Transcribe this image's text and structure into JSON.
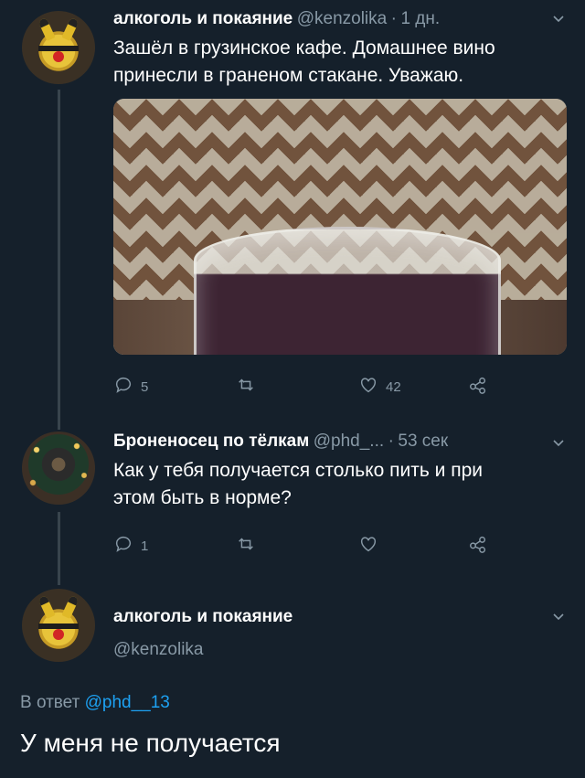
{
  "tweet1": {
    "author_name": "алкоголь и покаяние",
    "handle": "@kenzolika",
    "separator": "·",
    "time": "1 дн.",
    "text_line1": "Зашёл в грузинское кафе. Домашнее вино",
    "text_line2": "принесли в граненом стакане. Уважаю.",
    "reply_count": "5",
    "retweet_count": "",
    "like_count": "42"
  },
  "tweet2": {
    "author_name": "Броненосец по тёлкам",
    "handle": "@phd_...",
    "separator": "·",
    "time": "53 сек",
    "text_line1": "Как у тебя получается столько пить и при",
    "text_line2": "этом быть в норме?",
    "reply_count": "1",
    "retweet_count": "",
    "like_count": ""
  },
  "tweet3": {
    "author_name": "алкоголь и покаяние",
    "handle": "@kenzolika",
    "reply_prefix": "В ответ",
    "reply_mention": "@phd__13",
    "text": "У меня не получается"
  },
  "icons": {
    "reply": "reply-icon",
    "retweet": "retweet-icon",
    "like": "heart-icon",
    "share": "share-icon",
    "more": "chevron-down-icon"
  },
  "colors": {
    "background": "#15202b",
    "secondary_text": "#8899a6",
    "link": "#1da1f2",
    "thread_line": "#38444d"
  }
}
